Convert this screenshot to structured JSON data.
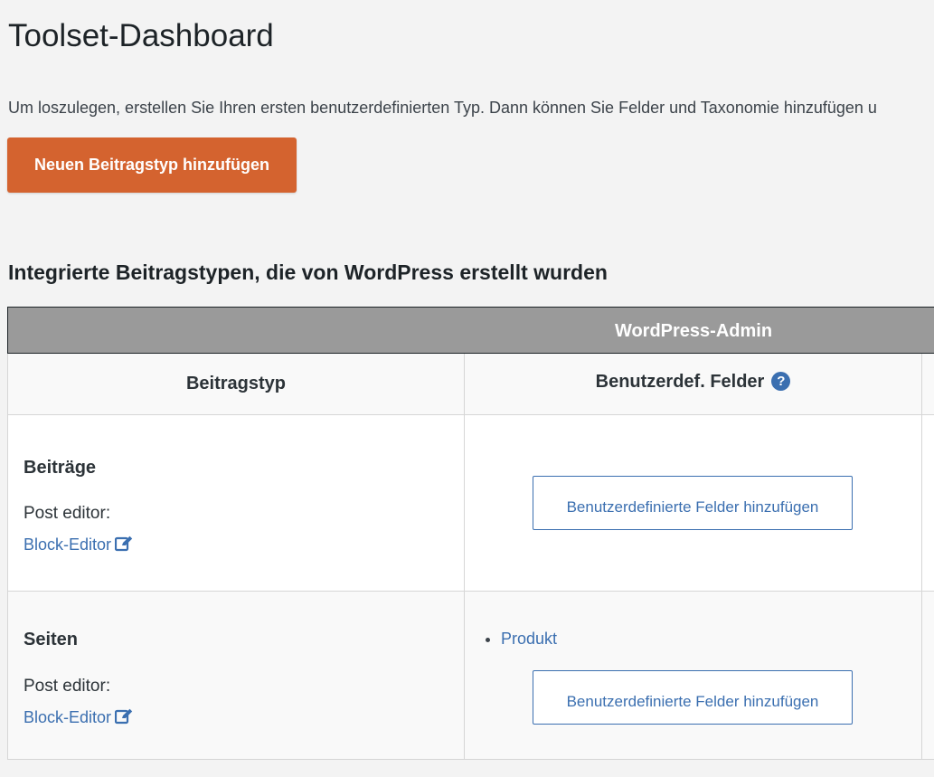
{
  "page": {
    "title": "Toolset-Dashboard",
    "intro": "Um loszulegen, erstellen Sie Ihren ersten benutzerdefinierten Typ. Dann können Sie Felder und Taxonomie hinzufügen u",
    "add_type_button": "Neuen Beitragstyp hinzufügen"
  },
  "section": {
    "title": "Integrierte Beitragstypen, die von WordPress erstellt wurden"
  },
  "table": {
    "group_header": "WordPress-Admin",
    "columns": {
      "post_type": "Beitragstyp",
      "custom_fields": "Benutzerdef. Felder",
      "help_icon_glyph": "?"
    },
    "rows": [
      {
        "name": "Beiträge",
        "editor_label": "Post editor:",
        "editor_link": "Block-Editor",
        "field_groups": [],
        "add_fields_button": "Benutzerdefinierte Felder hinzufügen"
      },
      {
        "name": "Seiten",
        "editor_label": "Post editor:",
        "editor_link": "Block-Editor",
        "field_groups": [
          "Produkt"
        ],
        "add_fields_button": "Benutzerdefinierte Felder hinzufügen"
      }
    ]
  },
  "colors": {
    "primary_button": "#d4632f",
    "link": "#3b6fb0",
    "group_header_bg": "#9a9a9a",
    "page_bg": "#f3f3f3"
  },
  "icons": {
    "help": "question-circle-icon",
    "edit": "edit-square-icon"
  }
}
